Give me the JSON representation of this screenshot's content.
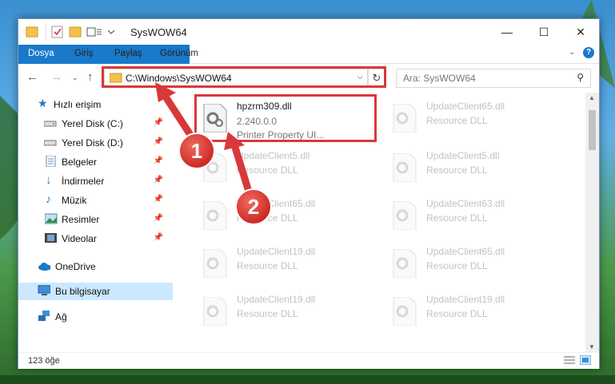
{
  "window": {
    "title": "SysWOW64"
  },
  "ribbon": {
    "tabs": [
      "Dosya",
      "Giriş",
      "Paylaş",
      "Görünüm"
    ]
  },
  "address": {
    "path": "C:\\Windows\\SysWOW64",
    "search_placeholder": "Ara: SysWOW64"
  },
  "nav": {
    "quick_access": "Hızlı erişim",
    "items": [
      {
        "label": "Yerel Disk (C:)",
        "pinned": true
      },
      {
        "label": "Yerel Disk (D:)",
        "pinned": true
      },
      {
        "label": "Belgeler",
        "pinned": true
      },
      {
        "label": "İndirmeler",
        "pinned": true
      },
      {
        "label": "Müzik",
        "pinned": true
      },
      {
        "label": "Resimler",
        "pinned": true
      },
      {
        "label": "Videolar",
        "pinned": true
      }
    ],
    "onedrive": "OneDrive",
    "this_pc": "Bu bilgisayar",
    "network": "Ağ"
  },
  "files": {
    "highlighted": {
      "name": "hpzrm309.dll",
      "version": "2.240.0.0",
      "description": "Printer Property UI..."
    },
    "left": [
      {
        "name": "UpdateClient5.dll",
        "type": "Resource DLL"
      },
      {
        "name": "UpdateClient65.dll",
        "type": "Resource DLL"
      },
      {
        "name": "UpdateClient19.dll",
        "type": "Resource DLL"
      },
      {
        "name": "UpdateClient19.dll",
        "type": "Resource DLL"
      }
    ],
    "right": [
      {
        "name": "UpdateClient65.dll",
        "type": "Resource DLL"
      },
      {
        "name": "UpdateClient5.dll",
        "type": "Resource DLL"
      },
      {
        "name": "UpdateClient63.dll",
        "type": "Resource DLL"
      },
      {
        "name": "UpdateClient65.dll",
        "type": "Resource DLL"
      },
      {
        "name": "UpdateClient19.dll",
        "type": "Resource DLL"
      }
    ]
  },
  "status": {
    "count": "123 öğe"
  },
  "annotations": {
    "step1": "1",
    "step2": "2"
  },
  "colors": {
    "accent": "#1979ca",
    "highlight": "#d9383a",
    "selected": "#cce8ff"
  }
}
